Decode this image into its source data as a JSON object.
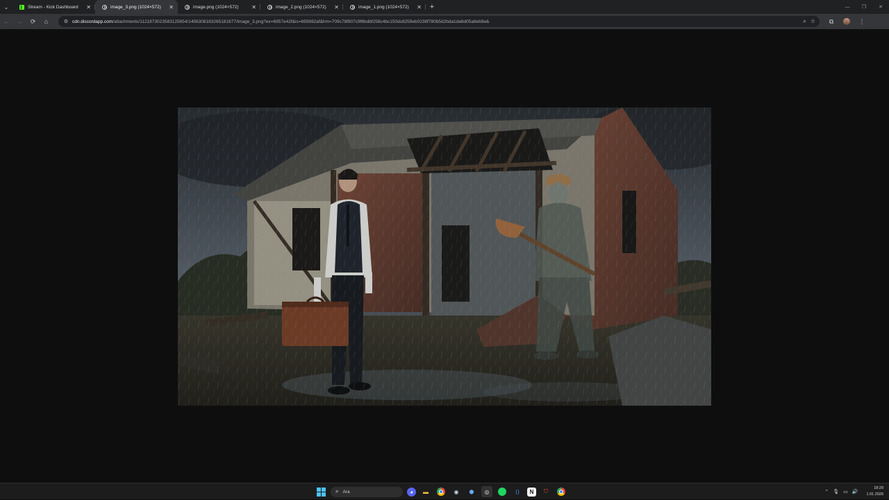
{
  "browser": {
    "tabs": [
      {
        "title": "Stream - Kick Dashboard",
        "icon": "kick-icon",
        "active": false
      },
      {
        "title": "image_3.png (1024×572)",
        "icon": "globe-icon",
        "active": true
      },
      {
        "title": "image.png (1024×572)",
        "icon": "globe-icon",
        "active": false
      },
      {
        "title": "image_2.png (1024×572)",
        "icon": "globe-icon",
        "active": false
      },
      {
        "title": "image_1.png (1024×572)",
        "icon": "globe-icon",
        "active": false
      }
    ],
    "url_host": "cdn.discordapp.com",
    "url_path": "/attachments/1121873023583125654/1456308183265181877/image_3.png?ex=6957e42f&is=695692af&hm=709c78f907c9f6bdbf258c4bc150dc8259eb0238f780b5d2bda1da6d05a8eb9e&"
  },
  "viewer": {
    "image_name": "image_3.png"
  },
  "taskbar": {
    "search_placeholder": "Ara",
    "apps": [
      "discord-icon",
      "file-explorer-icon",
      "chrome-icon",
      "steam-icon",
      "app-icon",
      "obs-icon",
      "spotify-icon",
      "vscode-icon",
      "notion-icon",
      "brave-icon",
      "chrome-icon"
    ],
    "time": "18:29",
    "date": "1.01.2026"
  },
  "colors": {
    "tab_strip": "#1f2123",
    "toolbar": "#35363a",
    "page_background": "#0e0e0e",
    "taskbar": "#1c1c1c",
    "windows_accent": "#4cc2ff"
  }
}
